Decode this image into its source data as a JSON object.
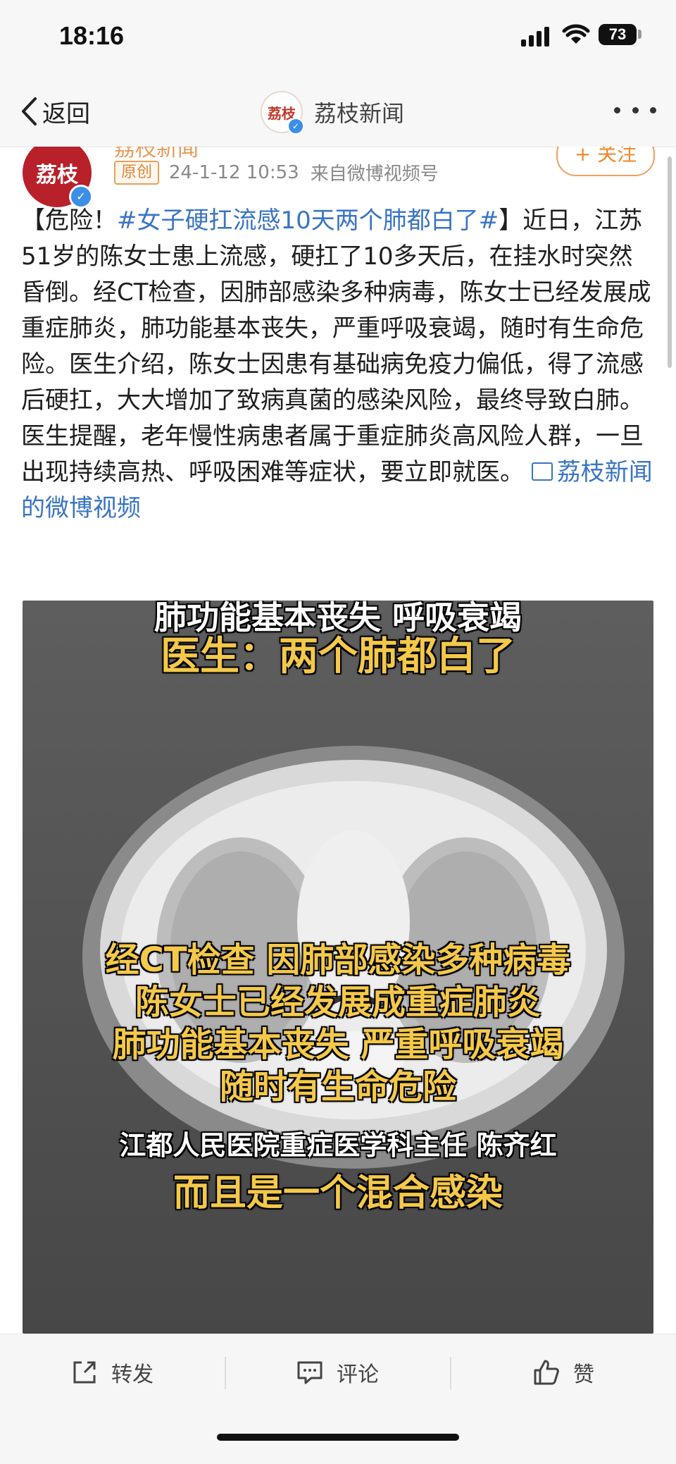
{
  "status_bar": {
    "time": "18:16",
    "battery": "73"
  },
  "nav": {
    "back_label": "返回",
    "title": "荔枝新闻",
    "avatar_text": "荔枝"
  },
  "author": {
    "name": "荔枝新闻",
    "avatar_text": "荔枝",
    "original_badge": "原创",
    "timestamp": "24-1-12 10:53",
    "source": "来自微博视频号",
    "follow_label": "+ 关注"
  },
  "post": {
    "prefix": "【危险！",
    "hashtag": "#女子硬扛流感10天两个肺都白了#",
    "suffix": "】",
    "body": "近日，江苏51岁的陈女士患上流感，硬扛了10多天后，在挂水时突然昏倒。经CT检查，因肺部感染多种病毒，陈女士已经发展成重症肺炎，肺功能基本丧失，严重呼吸衰竭，随时有生命危险。医生介绍，陈女士因患有基础病免疫力偏低，得了流感后硬扛，大大增加了致病真菌的感染风险，最终导致白肺。医生提醒，老年慢性病患者属于重症肺炎高风险人群，一旦出现持续高热、呼吸困难等症状，要立即就医。",
    "source_link": "荔枝新闻的微博视频"
  },
  "video": {
    "caption_top_cut": "肺功能基本丧失 呼吸衰竭",
    "caption_doctor": "医生：两个肺都白了",
    "caption_lines": [
      "经CT检查 因肺部感染多种病毒",
      "陈女士已经发展成重症肺炎",
      "肺功能基本丧失 严重呼吸衰竭",
      "随时有生命危险"
    ],
    "caption_name": "江都人民医院重症医学科主任 陈齐红",
    "caption_last": "而且是一个混合感染"
  },
  "actions": {
    "repost": "转发",
    "comment": "评论",
    "like": "赞"
  },
  "colors": {
    "link": "#3a74c4",
    "accent": "#f08a2a",
    "caption": "#f4c84a"
  }
}
